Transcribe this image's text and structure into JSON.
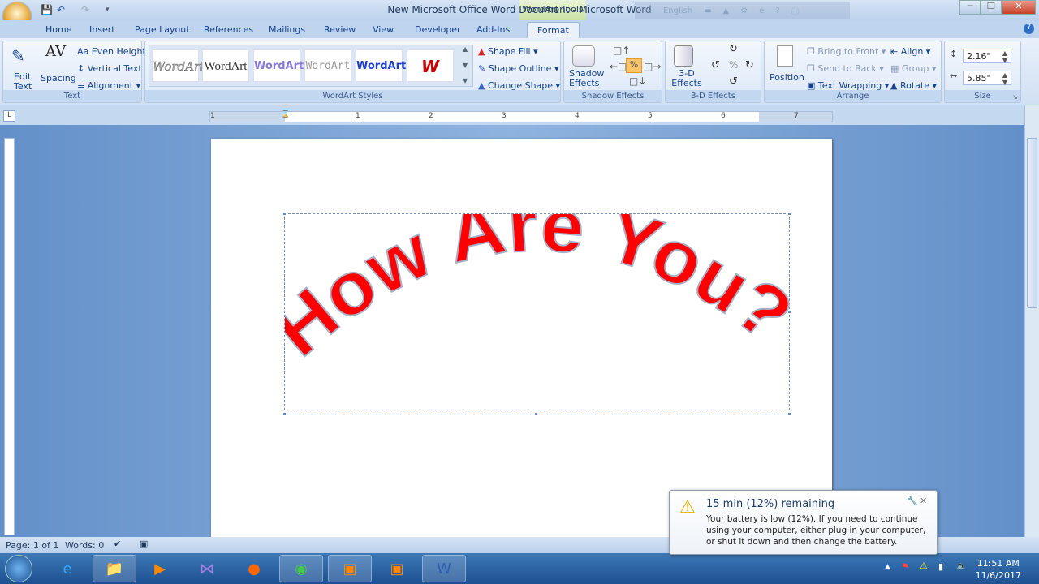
{
  "window": {
    "title": "New Microsoft Office Word Document - Microsoft Word",
    "context_tab": "WordArt Tools",
    "controls": [
      "minimize",
      "maximize",
      "close"
    ]
  },
  "language_bar": {
    "language": "English"
  },
  "tabs": [
    "Home",
    "Insert",
    "Page Layout",
    "References",
    "Mailings",
    "Review",
    "View",
    "Developer",
    "Add-Ins",
    "Format"
  ],
  "active_tab": "Format",
  "ribbon": {
    "text_group": {
      "label": "Text",
      "edit_text": "Edit Text",
      "spacing": "Spacing",
      "even_height": "Even Height",
      "vertical_text": "Vertical Text",
      "alignment": "Alignment"
    },
    "wordart_styles": {
      "label": "WordArt Styles",
      "gallery": [
        "WordArt",
        "WordArt",
        "WordArt",
        "WordArt",
        "WordArt",
        "W"
      ],
      "shape_fill": "Shape Fill",
      "shape_outline": "Shape Outline",
      "change_shape": "Change Shape"
    },
    "shadow": {
      "label": "Shadow Effects",
      "button": "Shadow Effects"
    },
    "three_d": {
      "label": "3-D Effects",
      "button": "3-D Effects"
    },
    "arrange": {
      "label": "Arrange",
      "position": "Position",
      "bring_to_front": "Bring to Front",
      "send_to_back": "Send to Back",
      "text_wrapping": "Text Wrapping",
      "align": "Align",
      "group": "Group",
      "rotate": "Rotate"
    },
    "size": {
      "label": "Size",
      "height": "2.16\"",
      "width": "5.85\""
    }
  },
  "ruler": {
    "numbers": [
      "1",
      "1",
      "2",
      "3",
      "4",
      "5",
      "6",
      "7"
    ]
  },
  "document": {
    "wordart_text": "How Are You?",
    "fill_color": "#ff0000"
  },
  "status": {
    "page": "Page: 1 of 1",
    "words": "Words: 0"
  },
  "taskbar": {
    "apps": [
      "start",
      "internet-explorer",
      "file-explorer",
      "media-player",
      "visual-studio",
      "firefox",
      "chrome",
      "screen-recorder",
      "screenshot",
      "word"
    ]
  },
  "notification": {
    "title": "15 min (12%) remaining",
    "body": "Your battery is low (12%). If you need to continue using your computer, either plug in your computer, or shut it down and then change the battery."
  },
  "clock": {
    "time": "11:51 AM",
    "date": "11/6/2017"
  }
}
